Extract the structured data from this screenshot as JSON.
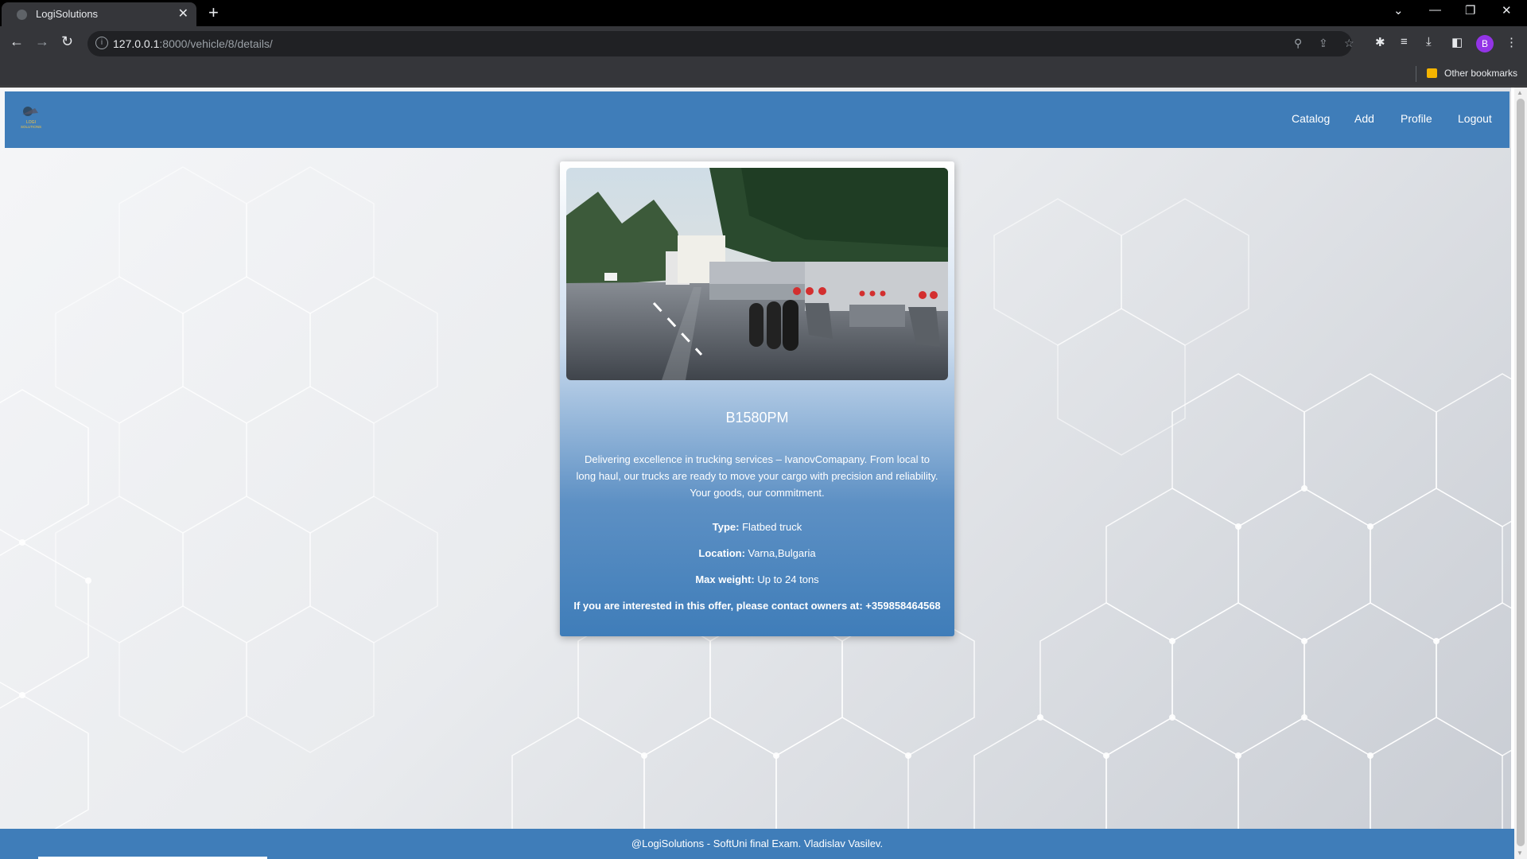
{
  "browser": {
    "tab_title": "LogiSolutions",
    "url_host": "127.0.0.1",
    "url_path": ":8000/vehicle/8/details/",
    "avatar_letter": "B",
    "bookmarks_folder": "Other bookmarks"
  },
  "navbar": {
    "logo_text": "LOGI SOLUTIONS",
    "links": [
      "Catalog",
      "Add",
      "Profile",
      "Logout"
    ]
  },
  "vehicle": {
    "plate": "B1580PM",
    "description": "Delivering excellence in trucking services – IvanovComapany. From local to long haul, our trucks are ready to move your cargo with precision and reliability. Your goods, our commitment.",
    "type_label": "Type:",
    "type_value": "Flatbed truck",
    "location_label": "Location:",
    "location_value": "Varna,Bulgaria",
    "max_weight_label": "Max weight:",
    "max_weight_value": "Up to 24 tons",
    "contact_text": "If you are interested in this offer, please contact owners at: +359858464568"
  },
  "footer": {
    "text": "@LogiSolutions - SoftUni final Exam. Vladislav Vasilev."
  },
  "colors": {
    "brand_blue": "#3f7db9",
    "avatar_purple": "#9334e6"
  }
}
